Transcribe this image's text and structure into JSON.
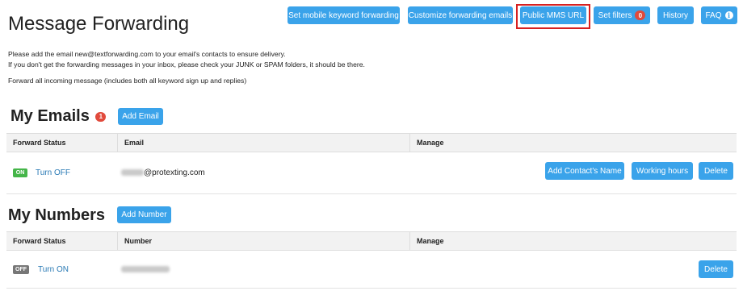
{
  "toolbar": {
    "mobile_keyword": "Set mobile keyword forwarding",
    "customize_emails": "Customize forwarding emails",
    "public_mms": "Public MMS URL",
    "set_filters": "Set filters",
    "filters_count": "0",
    "history": "History",
    "faq": "FAQ",
    "faq_icon": "i"
  },
  "page": {
    "title": "Message Forwarding",
    "info_line_1": "Please add the email new@textforwarding.com to your email's contacts to ensure delivery.",
    "info_line_2": "If you don't get the forwarding messages in your inbox, please check your JUNK or SPAM folders, it should be there.",
    "info_line_3": "Forward all incoming message (includes both all keyword sign up and replies)"
  },
  "emails": {
    "title": "My Emails",
    "badge": "1",
    "add_button": "Add Email",
    "columns": [
      "Forward Status",
      "Email",
      "Manage"
    ],
    "rows": [
      {
        "status": "ON",
        "toggle_label": "Turn OFF",
        "email_domain": "@protexting.com",
        "actions": [
          "Add Contact's Name",
          "Working hours",
          "Delete"
        ]
      }
    ]
  },
  "numbers": {
    "title": "My Numbers",
    "add_button": "Add Number",
    "columns": [
      "Forward Status",
      "Number",
      "Manage"
    ],
    "rows": [
      {
        "status": "OFF",
        "toggle_label": "Turn ON",
        "actions": [
          "Delete"
        ]
      }
    ]
  },
  "colors": {
    "primary_button": "#3aa3ea",
    "badge_red": "#e14a3c",
    "status_on": "#45b549",
    "status_off": "#777777",
    "link": "#2a7ab5",
    "highlight": "#d72020"
  }
}
